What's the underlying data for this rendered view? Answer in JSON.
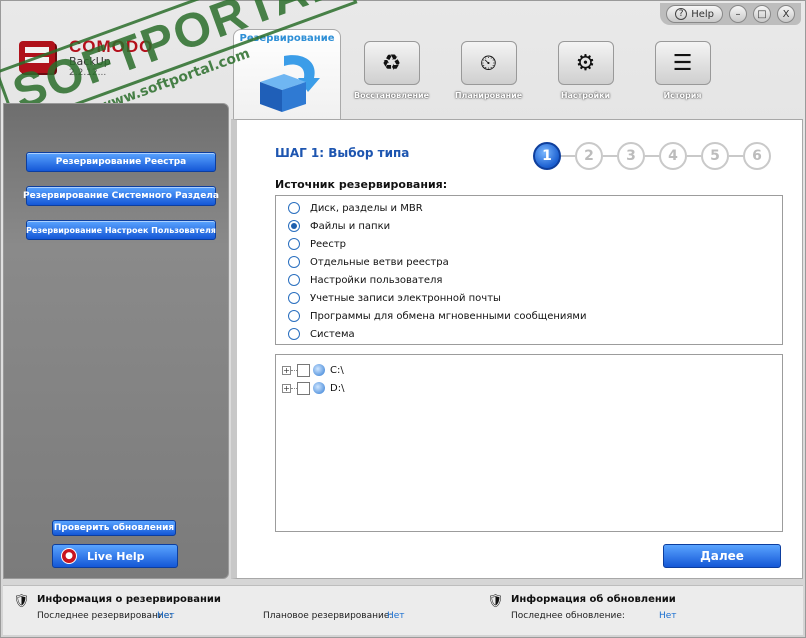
{
  "window": {
    "help_label": "Help",
    "help_icon": "?",
    "minimize_icon": "–",
    "maximize_icon": "□",
    "close_icon": "X"
  },
  "logo": {
    "brand": "COMODO",
    "product": "BackUp",
    "version": "2.2.12..."
  },
  "watermark": {
    "text": "SOFTPORTAL",
    "url": "www.softportal.com",
    "tm": "TM"
  },
  "tabs": {
    "active_label": "Резервирование",
    "items": [
      {
        "label": "Восстановление",
        "icon": "restore-icon",
        "glyph": "♻"
      },
      {
        "label": "Планирование",
        "icon": "schedule-icon",
        "glyph": "⏲"
      },
      {
        "label": "Настройки",
        "icon": "settings-icon",
        "glyph": "⚙"
      },
      {
        "label": "История",
        "icon": "history-icon",
        "glyph": "☰"
      }
    ]
  },
  "sidebar": {
    "buttons": [
      "Резервирование Реестра",
      "Резервирование Системного Раздела",
      "Резервирование Настроек Пользователя"
    ],
    "check_updates": "Проверить обновления",
    "live_help": "Live Help"
  },
  "main": {
    "step_title": "ШАГ 1: Выбор типа",
    "steps": [
      "1",
      "2",
      "3",
      "4",
      "5",
      "6"
    ],
    "active_step": 1,
    "source_label": "Источник резервирования:",
    "options": [
      "Диск, разделы и MBR",
      "Файлы и папки",
      "Реестр",
      "Отдельные ветви реестра",
      "Настройки пользователя",
      "Учетные записи электронной почты",
      "Программы для обмена мгновенными сообщениями",
      "Система"
    ],
    "selected_option": 1,
    "tree": [
      "C:\\",
      "D:\\"
    ],
    "next_label": "Далее"
  },
  "status": {
    "backup_info_title": "Информация о резервировании",
    "last_backup_label": "Последнее резервирование:",
    "last_backup_value": "Нет",
    "scheduled_label": "Плановое резервирование:",
    "scheduled_value": "Нет",
    "update_info_title": "Информация об обновлении",
    "last_update_label": "Последнее обновление:",
    "last_update_value": "Нет"
  }
}
